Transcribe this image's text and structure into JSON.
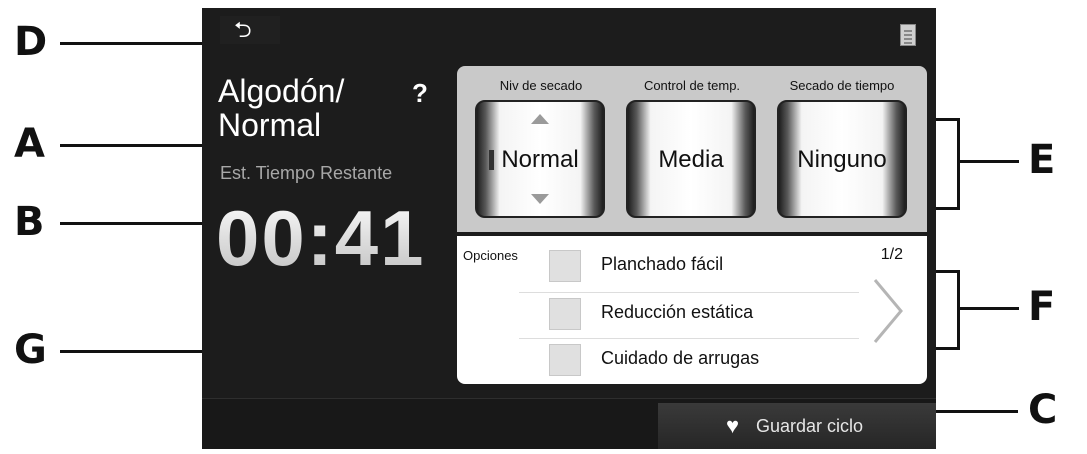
{
  "callouts": {
    "d": "D",
    "a": "A",
    "b": "B",
    "g": "G",
    "e": "E",
    "f": "F",
    "c": "C"
  },
  "cycle": {
    "title_line1": "Algodón/",
    "title_line2": "Normal",
    "help": "?"
  },
  "timer": {
    "label": "Est. Tiempo Restante",
    "value": "00:41"
  },
  "settings": [
    {
      "label": "Niv de secado",
      "value": "Normal"
    },
    {
      "label": "Control de temp.",
      "value": "Media"
    },
    {
      "label": "Secado de tiempo",
      "value": "Ninguno"
    }
  ],
  "options": {
    "label": "Opciones",
    "page": "1/2",
    "items": [
      {
        "label": "Planchado fácil",
        "checked": false
      },
      {
        "label": "Reducción estática",
        "checked": false
      },
      {
        "label": "Cuidado de arrugas",
        "checked": false
      }
    ]
  },
  "footer": {
    "save_label": "Guardar ciclo",
    "save_icon": "heart-icon"
  },
  "icons": {
    "back": "back-arrow-icon",
    "menu": "document-icon",
    "next": "chevron-right-icon"
  },
  "colors": {
    "screen_bg": "#1c1c1c",
    "settings_bg": "#c9c9c9",
    "options_bg": "#ffffff"
  }
}
